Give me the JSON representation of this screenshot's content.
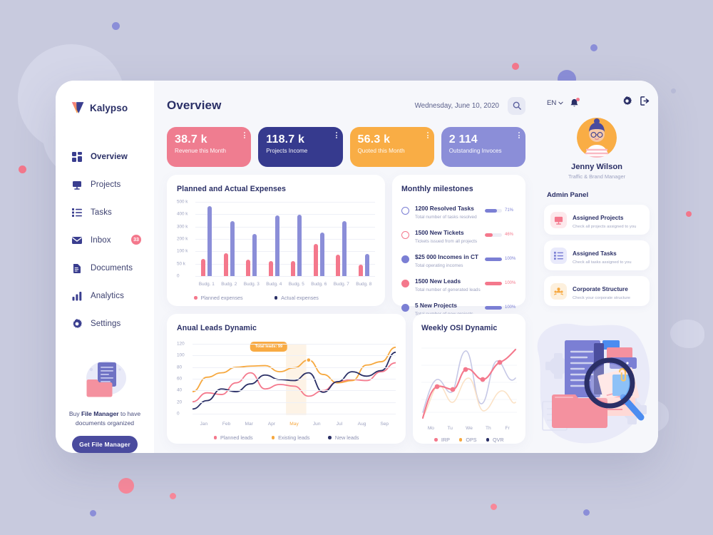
{
  "brand": {
    "name": "Kalypso",
    "logo_icon": "kalypso-v-logo"
  },
  "sidebar": {
    "items": [
      {
        "label": "Overview",
        "icon": "grid-icon",
        "active": true
      },
      {
        "label": "Projects",
        "icon": "presentation-icon",
        "active": false
      },
      {
        "label": "Tasks",
        "icon": "list-icon",
        "active": false
      },
      {
        "label": "Inbox",
        "icon": "envelope-icon",
        "active": false,
        "badge": "33"
      },
      {
        "label": "Documents",
        "icon": "document-icon",
        "active": false
      },
      {
        "label": "Analytics",
        "icon": "bar-chart-icon",
        "active": false
      },
      {
        "label": "Settings",
        "icon": "gear-icon",
        "active": false
      }
    ],
    "promo": {
      "text_before": "Buy ",
      "text_bold": "File Manager",
      "text_after": " to have documents organized",
      "button": "Get File Manager",
      "illustration": "file-manager-illustration"
    }
  },
  "header": {
    "title": "Overview",
    "date": "Wednesday, June 10, 2020",
    "search_icon": "search-icon",
    "language": "EN",
    "chevron_icon": "chevron-down-icon",
    "bell_icon": "bell-notification-icon",
    "gear_icon": "gear-icon",
    "logout_icon": "logout-icon"
  },
  "kpis": [
    {
      "value": "38.7 k",
      "label": "Revenue this Month",
      "color": "#ef7d90"
    },
    {
      "value": "118.7 k",
      "label": "Projects Income",
      "color": "#363a8e"
    },
    {
      "value": "56.3 k",
      "label": "Quoted this Month",
      "color": "#f9ad45"
    },
    {
      "value": "2 114",
      "label": "Outstanding Invoces",
      "color": "#8b8ed8"
    }
  ],
  "milestones": {
    "title": "Monthly milestones",
    "items": [
      {
        "title": "1200 Resolved Tasks",
        "subtitle": "Total number of tasks resolved",
        "percent": "71%",
        "value": 71,
        "color": "#7b7fd4",
        "dot": "hollow"
      },
      {
        "title": "1500 New Tickets",
        "subtitle": "Tickets issued from all projects",
        "percent": "46%",
        "value": 46,
        "color": "#f4788c",
        "dot": "hollow"
      },
      {
        "title": "$25 000 Incomes in CT",
        "subtitle": "Total operating incomes",
        "percent": "100%",
        "value": 100,
        "color": "#7b7fd4",
        "dot": "solid"
      },
      {
        "title": "1500 New Leads",
        "subtitle": "Total number of generated leads",
        "percent": "100%",
        "value": 100,
        "color": "#f4788c",
        "dot": "solid"
      },
      {
        "title": "5 New Projects",
        "subtitle": "Total number of new projects",
        "percent": "100%",
        "value": 100,
        "color": "#7b7fd4",
        "dot": "solid"
      }
    ]
  },
  "user": {
    "name": "Jenny Wilson",
    "role": "Traffic & Brand Manager",
    "avatar_icon": "user-avatar"
  },
  "admin_panel": {
    "title": "Admin Panel",
    "cards": [
      {
        "title": "Assigned Projects",
        "subtitle": "Check all projects assigned to you",
        "icon": "presentation-icon",
        "bg": "#fde9ec",
        "fg": "#f4788c"
      },
      {
        "title": "Assigned Tasks",
        "subtitle": "Check all tasks assigned to you",
        "icon": "list-icon",
        "bg": "#e9eafb",
        "fg": "#7b7fd4"
      },
      {
        "title": "Corporate Structure",
        "subtitle": "Check your corporate structure",
        "icon": "people-icon",
        "bg": "#fdf0dd",
        "fg": "#f6a83f"
      }
    ]
  },
  "right_illustration": "documents-magnifier-illustration",
  "chart_data": [
    {
      "type": "bar",
      "title": "Planned and Actual Expenses",
      "categories": [
        "Budg. 1",
        "Budg. 2",
        "Budg. 3",
        "Budg. 4",
        "Budg. 5",
        "Budg. 6",
        "Budg. 7",
        "Budg. 8"
      ],
      "series": [
        {
          "name": "Planned expenses",
          "color": "#f4788c",
          "values": [
            85,
            125,
            80,
            68,
            68,
            195,
            115,
            45
          ]
        },
        {
          "name": "Actual expenses",
          "color": "#8b8ed8",
          "values": [
            470,
            360,
            265,
            403,
            405,
            275,
            360,
            122
          ]
        }
      ],
      "ylabel": "",
      "xlabel": "",
      "yticks": [
        "0",
        "50 k",
        "100 k",
        "200 k",
        "300 k",
        "400 k",
        "500 k"
      ],
      "ylim": [
        0,
        500
      ],
      "grid": true,
      "legend_position": "bottom"
    },
    {
      "type": "line",
      "title": "Anual Leads Dynamic",
      "x": [
        "Jan",
        "Feb",
        "Mar",
        "Apr",
        "May",
        "Jun",
        "Jul",
        "Aug",
        "Sep"
      ],
      "yticks": [
        "0",
        "20",
        "40",
        "60",
        "80",
        "100",
        "120"
      ],
      "ylim": [
        0,
        128
      ],
      "highlight_x": "May",
      "annotation": "Total leads: 99",
      "series": [
        {
          "name": "Planned leads",
          "color": "#f4788c",
          "values": [
            24,
            40,
            37,
            58,
            76,
            47,
            55,
            52,
            34,
            44,
            60,
            64,
            62,
            78,
            94
          ]
        },
        {
          "name": "Existing leads",
          "color": "#f6a83f",
          "values": [
            42,
            68,
            76,
            86,
            88,
            89,
            78,
            85,
            99,
            73,
            58,
            62,
            90,
            96,
            122
          ]
        },
        {
          "name": "New leads",
          "color": "#2a2f66",
          "values": [
            11,
            26,
            47,
            42,
            56,
            72,
            64,
            62,
            76,
            41,
            60,
            78,
            70,
            80,
            113
          ]
        }
      ],
      "grid": true,
      "legend_position": "bottom"
    },
    {
      "type": "line",
      "title": "Weekly OSI Dynamic",
      "x": [
        "Mo",
        "Tu",
        "We",
        "Th",
        "Fr"
      ],
      "series": [
        {
          "name": "IRP",
          "color": "#f4788c"
        },
        {
          "name": "OPS",
          "color": "#f6a83f"
        },
        {
          "name": "QVR",
          "color": "#2a2f66"
        }
      ],
      "grid": true,
      "legend_position": "bottom"
    }
  ]
}
